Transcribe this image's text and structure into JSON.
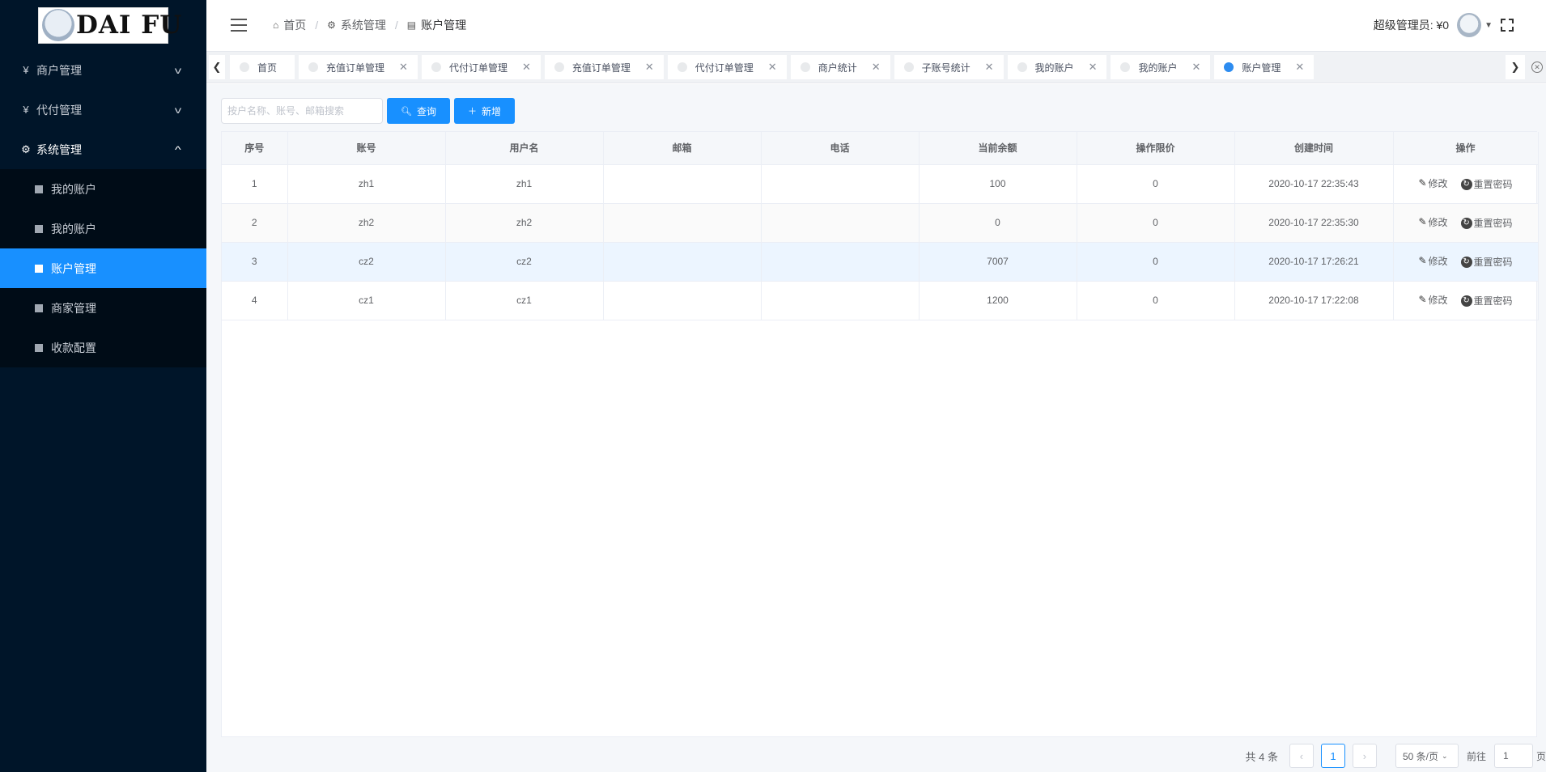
{
  "logo": {
    "text": "DAI FU"
  },
  "sidebar": {
    "menus": [
      {
        "icon": "¥",
        "label": "商户管理",
        "open": false
      },
      {
        "icon": "¥",
        "label": "代付管理",
        "open": false
      },
      {
        "icon": "⚙",
        "label": "系统管理",
        "open": true
      }
    ],
    "submenu": [
      {
        "label": "我的账户",
        "active": false
      },
      {
        "label": "我的账户",
        "active": false
      },
      {
        "label": "账户管理",
        "active": true
      },
      {
        "label": "商家管理",
        "active": false
      },
      {
        "label": "收款配置",
        "active": false
      }
    ]
  },
  "header": {
    "breadcrumb": [
      {
        "icon": "home-icon",
        "label": "首页"
      },
      {
        "icon": "gear-icon",
        "label": "系统管理"
      },
      {
        "icon": "list-icon",
        "label": "账户管理"
      }
    ],
    "admin_label": "超级管理员: ¥0"
  },
  "tags": [
    {
      "label": "首页",
      "closable": false,
      "active": false
    },
    {
      "label": "充值订单管理",
      "closable": true,
      "active": false
    },
    {
      "label": "代付订单管理",
      "closable": true,
      "active": false
    },
    {
      "label": "充值订单管理",
      "closable": true,
      "active": false
    },
    {
      "label": "代付订单管理",
      "closable": true,
      "active": false
    },
    {
      "label": "商户统计",
      "closable": true,
      "active": false
    },
    {
      "label": "子账号统计",
      "closable": true,
      "active": false
    },
    {
      "label": "我的账户",
      "closable": true,
      "active": false
    },
    {
      "label": "我的账户",
      "closable": true,
      "active": false
    },
    {
      "label": "账户管理",
      "closable": true,
      "active": true
    }
  ],
  "toolbar": {
    "search_placeholder": "按户名称、账号、邮箱搜索",
    "search_value": "",
    "query_label": "查询",
    "add_label": "新增"
  },
  "table": {
    "columns": [
      "序号",
      "账号",
      "用户名",
      "邮箱",
      "电话",
      "当前余额",
      "操作限价",
      "创建时间",
      "操作"
    ],
    "rows": [
      {
        "index": "1",
        "account": "zh1",
        "username": "zh1",
        "email": "",
        "phone": "",
        "balance": "100",
        "limit": "0",
        "created": "2020-10-17 22:35:43"
      },
      {
        "index": "2",
        "account": "zh2",
        "username": "zh2",
        "email": "",
        "phone": "",
        "balance": "0",
        "limit": "0",
        "created": "2020-10-17 22:35:30"
      },
      {
        "index": "3",
        "account": "cz2",
        "username": "cz2",
        "email": "",
        "phone": "",
        "balance": "7007",
        "limit": "0",
        "created": "2020-10-17 17:26:21"
      },
      {
        "index": "4",
        "account": "cz1",
        "username": "cz1",
        "email": "",
        "phone": "",
        "balance": "1200",
        "limit": "0",
        "created": "2020-10-17 17:22:08"
      }
    ],
    "edit_label": "修改",
    "reset_label": "重置密码"
  },
  "pagination": {
    "total_text": "共 4 条",
    "current_page": "1",
    "page_size": "50 条/页",
    "goto_label": "前往",
    "goto_value": "1",
    "page_suffix": "页"
  }
}
